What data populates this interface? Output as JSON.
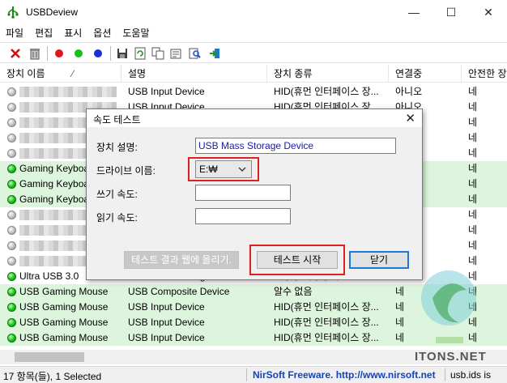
{
  "window": {
    "title": "USBDeview",
    "controls": {
      "minimize": "—",
      "maximize": "☐",
      "close": "✕"
    }
  },
  "menu": [
    "파일",
    "편집",
    "표시",
    "옵션",
    "도움말"
  ],
  "toolbar": {
    "icons": [
      "delete-icon",
      "uninstall-icon",
      "red-dot-icon",
      "green-dot-icon",
      "blue-dot-icon",
      "save-icon",
      "refresh-icon",
      "copy-icon",
      "properties-icon",
      "find-icon",
      "exit-icon"
    ]
  },
  "columns": [
    "장치 이름",
    "설명",
    "장치 종류",
    "연결중",
    "안전한 장"
  ],
  "sort_indicator": "⁄",
  "rows": [
    {
      "status": "gray",
      "name": "",
      "blurred": true,
      "desc": "USB Input Device",
      "type": "HID(휴먼 인터페이스 장...",
      "connected": "아니오",
      "safe": "네",
      "green": false
    },
    {
      "status": "gray",
      "name": "",
      "blurred": true,
      "desc": "USB Input Device",
      "type": "HID(휴먼 인터페이스 장...",
      "connected": "아니오",
      "safe": "네",
      "green": false
    },
    {
      "status": "gray",
      "name": "",
      "blurred": true,
      "desc": "",
      "type": "",
      "connected": "",
      "safe": "네",
      "green": false
    },
    {
      "status": "gray",
      "name": "",
      "blurred": true,
      "desc": "",
      "type": "",
      "connected": "",
      "safe": "네",
      "green": false
    },
    {
      "status": "gray",
      "name": "",
      "blurred": true,
      "desc": "",
      "type": "",
      "connected": "",
      "safe": "네",
      "green": false
    },
    {
      "status": "green",
      "name": "Gaming Keyboard",
      "blurred": false,
      "desc": "",
      "type": "",
      "connected": "",
      "safe": "네",
      "green": true
    },
    {
      "status": "green",
      "name": "Gaming Keyboard",
      "blurred": false,
      "desc": "",
      "type": "",
      "connected": "",
      "safe": "네",
      "green": true
    },
    {
      "status": "green",
      "name": "Gaming Keyboard",
      "blurred": false,
      "desc": "",
      "type": "",
      "connected": "",
      "safe": "네",
      "green": true
    },
    {
      "status": "gray",
      "name": "",
      "blurred": true,
      "desc": "",
      "type": "",
      "connected": "",
      "safe": "네",
      "green": false
    },
    {
      "status": "gray",
      "name": "",
      "blurred": true,
      "desc": "",
      "type": "",
      "connected": "",
      "safe": "네",
      "green": false
    },
    {
      "status": "gray",
      "name": "",
      "blurred": true,
      "desc": "",
      "type": "",
      "connected": "",
      "safe": "네",
      "green": false
    },
    {
      "status": "gray",
      "name": "",
      "blurred": true,
      "desc": "",
      "type": "",
      "connected": "",
      "safe": "네",
      "green": false
    },
    {
      "status": "green",
      "name": "Ultra USB 3.0",
      "blurred": false,
      "desc": "USB Mass Storage Device",
      "type": "대용량 저장장치",
      "connected": "",
      "safe": "네",
      "green": false
    },
    {
      "status": "green",
      "name": "USB Gaming Mouse",
      "blurred": false,
      "desc": "USB Composite Device",
      "type": "알수 없음",
      "connected": "네",
      "safe": "네",
      "green": true
    },
    {
      "status": "green",
      "name": "USB Gaming Mouse",
      "blurred": false,
      "desc": "USB Input Device",
      "type": "HID(휴먼 인터페이스 장...",
      "connected": "네",
      "safe": "네",
      "green": true
    },
    {
      "status": "green",
      "name": "USB Gaming Mouse",
      "blurred": false,
      "desc": "USB Input Device",
      "type": "HID(휴먼 인터페이스 장...",
      "connected": "네",
      "safe": "네",
      "green": true
    },
    {
      "status": "green",
      "name": "USB Gaming Mouse",
      "blurred": false,
      "desc": "USB Input Device",
      "type": "HID(휴먼 인터페이스 장...",
      "connected": "네",
      "safe": "네",
      "green": true
    }
  ],
  "status": {
    "count": "17 항목(들), 1 Selected",
    "link": "NirSoft Freeware.  http://www.nirsoft.net",
    "right": "usb.ids is"
  },
  "watermark": "ITONS.NET",
  "dialog": {
    "title": "속도 테스트",
    "close": "✕",
    "device_desc_label": "장치 설명:",
    "device_desc_value": "USB Mass Storage Device",
    "drive_label": "드라이브 이름:",
    "drive_value": "E:₩",
    "write_label": "쓰기 속도:",
    "write_value": "",
    "read_label": "읽기 속도:",
    "read_value": "",
    "btn_upload": "테스트 결과 웹에 올리기.",
    "btn_start": "테스트 시작",
    "btn_close": "닫기"
  }
}
